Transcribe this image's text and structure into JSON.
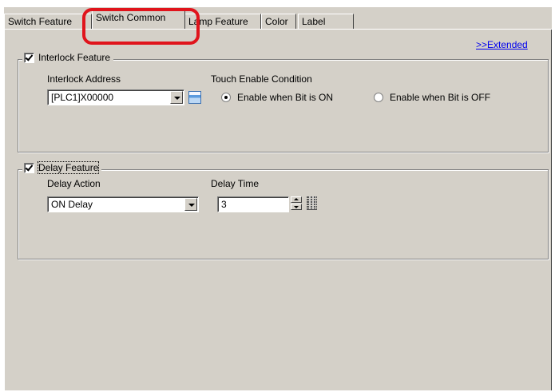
{
  "tabs": [
    {
      "label": "Switch Feature"
    },
    {
      "label": "Switch Common"
    },
    {
      "label": "Lamp Feature"
    },
    {
      "label": "Color"
    },
    {
      "label": "Label"
    }
  ],
  "extended_link": ">>Extended",
  "interlock": {
    "legend": "Interlock Feature",
    "checked": true,
    "address_label": "Interlock Address",
    "address_value": "[PLC1]X00000",
    "touch_enable_label": "Touch Enable Condition",
    "option_on": "Enable when Bit is ON",
    "option_off": "Enable when Bit is OFF",
    "selected_option": "Enable when Bit is ON"
  },
  "delay": {
    "legend": "Delay Feature",
    "checked": true,
    "action_label": "Delay Action",
    "action_value": "ON Delay",
    "time_label": "Delay Time",
    "time_value": "3"
  },
  "highlight_color": "#e0141c"
}
